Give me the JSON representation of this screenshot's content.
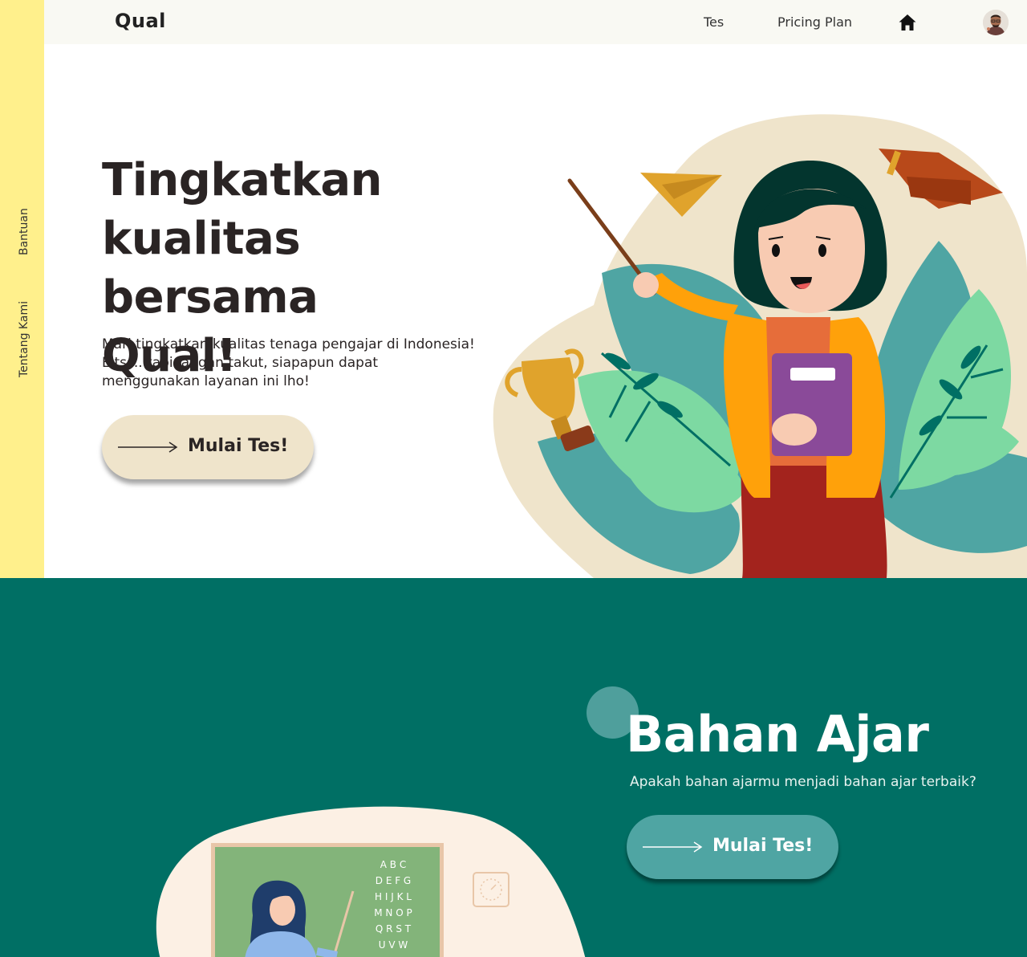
{
  "sidebar": {
    "links": [
      "Bantuan",
      "Tentang Kami"
    ]
  },
  "nav": {
    "logo": "Qual",
    "links": [
      "Tes",
      "Pricing Plan"
    ],
    "home_icon": "home-icon",
    "avatar": "user-avatar"
  },
  "hero": {
    "title_lines": [
      "Tingkatkan",
      "kualitas bersama",
      "Qual!"
    ],
    "subtitle": "Mari tingkatkan kualitas tenaga pengajar di Indonesia! Eitss.. tapi jangan takut, siapapun dapat menggunakan layanan ini lho!",
    "cta_label": "Mulai Tes!",
    "cta_icon": "arrow-right-icon"
  },
  "section2": {
    "title": "Bahan Ajar",
    "subtitle": "Apakah bahan ajarmu menjadi bahan ajar terbaik?",
    "cta_label": "Mulai Tes!",
    "chalkboard_letters": [
      "A B C",
      "D E F G",
      "H I J K L",
      "M N O P",
      "Q R S T",
      "U V W"
    ]
  },
  "colors": {
    "rail": "#fff08c",
    "topbar": "#f9f9f3",
    "hero_cta": "#efe4cb",
    "section2_bg": "#006f64",
    "section2_cta": "#4fa5a3"
  }
}
